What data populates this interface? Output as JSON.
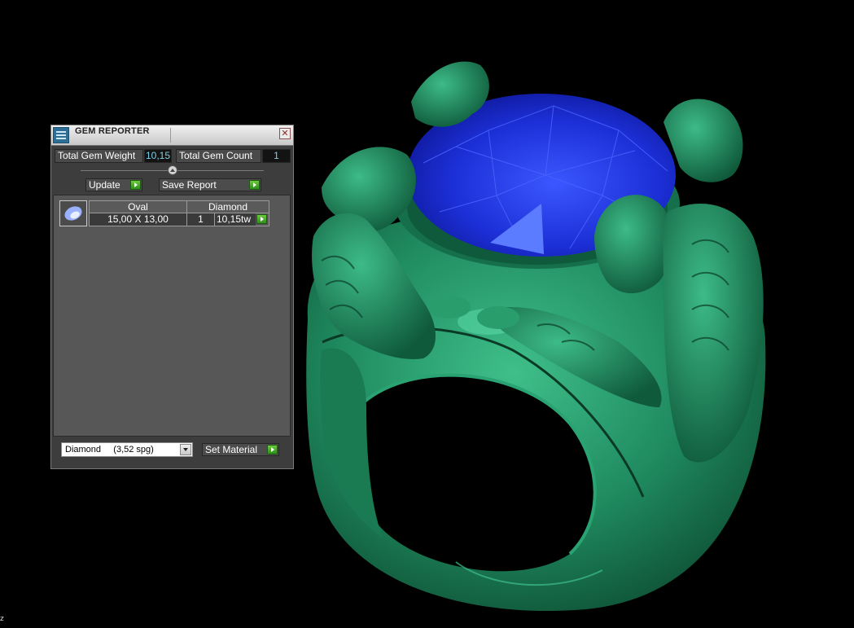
{
  "panel": {
    "title": "GEM REPORTER",
    "close_label": "✕"
  },
  "stats": {
    "total_gem_weight_label": "Total Gem Weight",
    "total_gem_weight_value": "10,15",
    "total_gem_count_label": "Total Gem Count",
    "total_gem_count_value": "1"
  },
  "actions": {
    "update_label": "Update",
    "save_report_label": "Save Report"
  },
  "gem_list": {
    "columns": [
      "Oval",
      "Diamond"
    ],
    "rows": [
      {
        "size": "15,00 X 13,00",
        "count": "1",
        "weight": "10,15tw"
      }
    ]
  },
  "material": {
    "selected": "Diamond     (3,52 spg)",
    "set_label": "Set Material"
  },
  "viewport": {
    "corner_text": "z",
    "colors": {
      "ring": "#1e8a5e",
      "gem": "#1a2fd0",
      "background": "#000000"
    }
  }
}
